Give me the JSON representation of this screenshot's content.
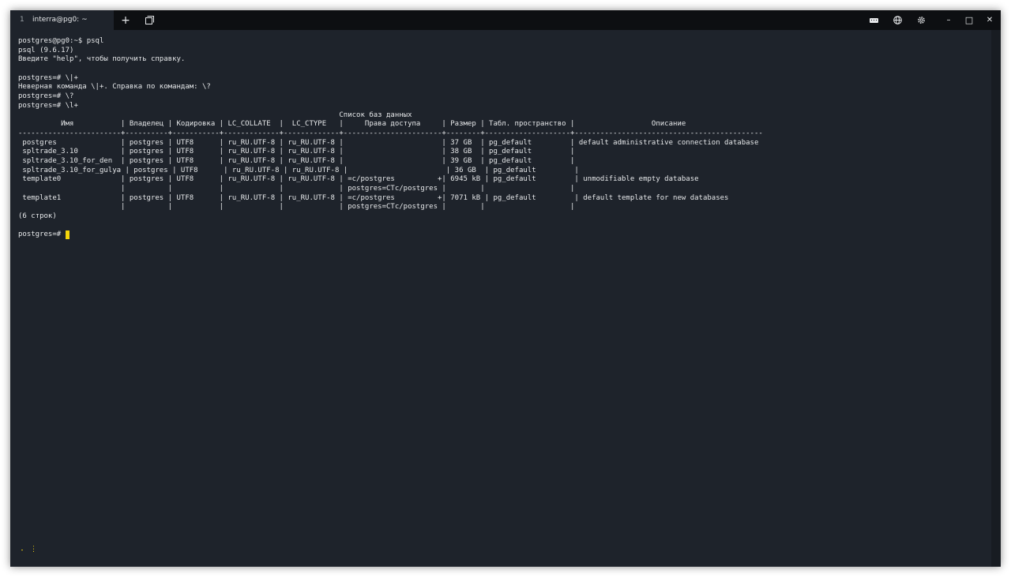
{
  "window": {
    "tab": {
      "number": "1",
      "title": "interra@pg0: ~"
    },
    "buttons": {
      "new_tab": "+",
      "minimize": "–",
      "maximize": "□",
      "close": "✕"
    },
    "icons": [
      "new-tab-icon",
      "tabs-overview-icon",
      "keyboard-icon",
      "globe-icon",
      "settings-icon",
      "minimize-icon",
      "maximize-icon",
      "close-icon"
    ]
  },
  "terminal": {
    "lines": [
      "postgres@pg0:~$ psql",
      "psql (9.6.17)",
      "Введите \"help\", чтобы получить справку.",
      "",
      "postgres=# \\|+",
      "Неверная команда \\|+. Справка по командам: \\?",
      "postgres=# \\?",
      "postgres=# \\l+",
      "                                                                           Список баз данных",
      "          Имя           | Владелец | Кодировка | LC_COLLATE  |  LC_CTYPE   |     Права доступа     | Размер | Табл. пространство |                  Описание",
      "------------------------+----------+-----------+-------------+-------------+-----------------------+--------+--------------------+--------------------------------------------",
      " postgres               | postgres | UTF8      | ru_RU.UTF-8 | ru_RU.UTF-8 |                       | 37 GB  | pg_default         | default administrative connection database",
      " spltrade_3.10          | postgres | UTF8      | ru_RU.UTF-8 | ru_RU.UTF-8 |                       | 38 GB  | pg_default         |",
      " spltrade_3.10_for_den  | postgres | UTF8      | ru_RU.UTF-8 | ru_RU.UTF-8 |                       | 39 GB  | pg_default         |",
      " spltrade_3.10_for_gulya | postgres | UTF8      | ru_RU.UTF-8 | ru_RU.UTF-8 |                       | 36 GB  | pg_default         |",
      " template0              | postgres | UTF8      | ru_RU.UTF-8 | ru_RU.UTF-8 | =c/postgres          +| 6945 kB | pg_default         | unmodifiable empty database",
      "                        |          |           |             |             | postgres=CTc/postgres |        |                    |",
      " template1              | postgres | UTF8      | ru_RU.UTF-8 | ru_RU.UTF-8 | =c/postgres          +| 7071 kB | pg_default         | default template for new databases",
      "                        |          |           |             |             | postgres=CTc/postgres |        |                    |",
      "(6 строк)",
      ""
    ],
    "prompt": "postgres=# "
  },
  "statusbar": {
    "text": "⠄ ⋮"
  },
  "colors": {
    "background": "#1e232b",
    "titlebar": "#0d0f12",
    "text": "#e6e8ea",
    "cursor": "#f5d60b"
  }
}
